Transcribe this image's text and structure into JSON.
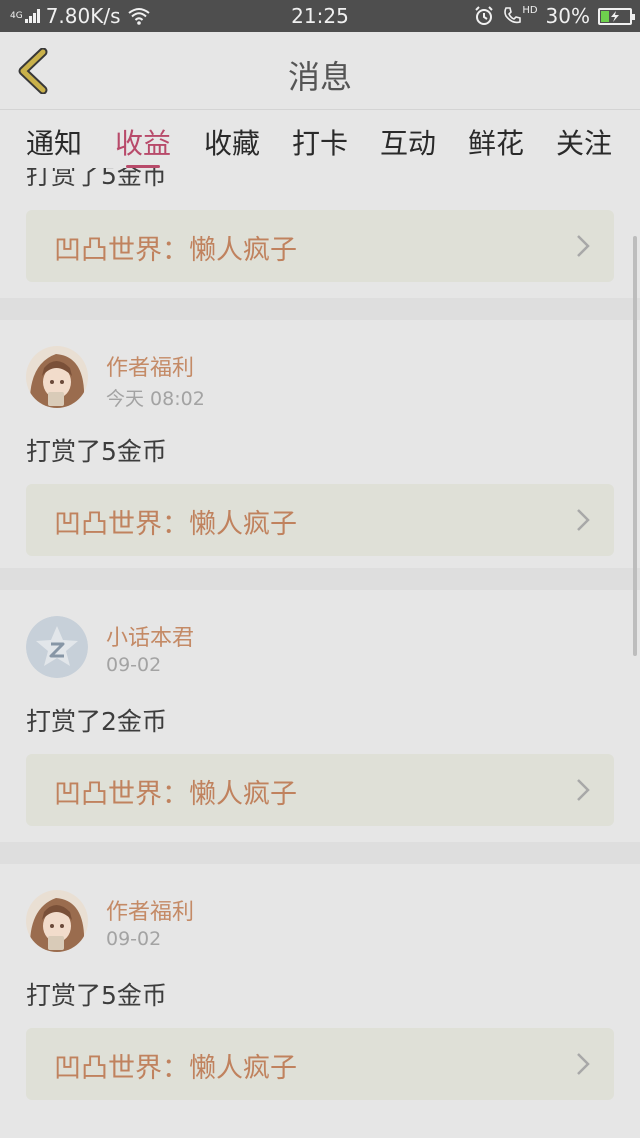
{
  "status_bar": {
    "network_type": "4G",
    "speed": "7.80K/s",
    "time": "21:25",
    "hd_label": "HD",
    "battery": "30%",
    "battery_level": 0.3
  },
  "header": {
    "title": "消息",
    "back_icon": "chevron-left-icon"
  },
  "tabs": [
    "通知",
    "收益",
    "收藏",
    "打卡",
    "互动",
    "鲜花",
    "关注"
  ],
  "active_tab": "收益",
  "colors": {
    "accent": "#b84a6a",
    "author": "#c48a66",
    "book_title": "#c0825e",
    "battery_fill": "#6ed04d"
  },
  "items": [
    {
      "reward": "打赏了5金币",
      "book": "凹凸世界：懒人疯子"
    },
    {
      "author": "作者福利",
      "time": "今天 08:02",
      "reward": "打赏了5金币",
      "book": "凹凸世界：懒人疯子",
      "avatar": "anime-girl-avatar"
    },
    {
      "author": "小话本君",
      "time": "09-02",
      "reward": "打赏了2金币",
      "book": "凹凸世界：懒人疯子",
      "avatar": "star-z-avatar"
    },
    {
      "author": "作者福利",
      "time": "09-02",
      "reward": "打赏了5金币",
      "book": "凹凸世界：懒人疯子",
      "avatar": "anime-girl-avatar"
    }
  ]
}
